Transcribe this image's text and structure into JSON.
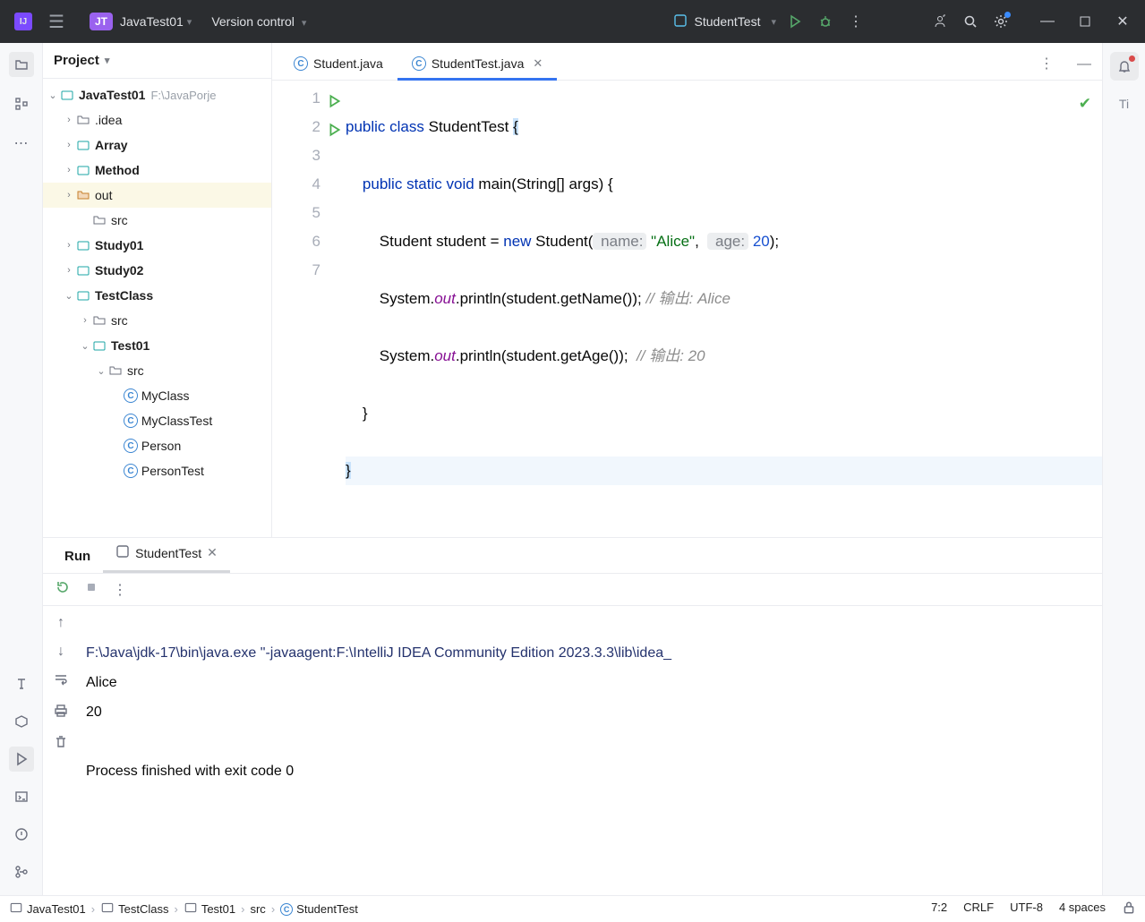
{
  "titlebar": {
    "project_badge": "JT",
    "project_name": "JavaTest01",
    "vcs_label": "Version control",
    "run_config": "StudentTest"
  },
  "project_panel": {
    "title": "Project",
    "root": {
      "name": "JavaTest01",
      "path": "F:\\JavaPorje"
    },
    "folders_top": [
      ".idea",
      "Array",
      "Method"
    ],
    "selected_folder": "out",
    "src_folder": "src",
    "folders_mid": [
      "Study01",
      "Study02"
    ],
    "testclass": "TestClass",
    "testclass_src": "src",
    "test01": "Test01",
    "test01_src": "src",
    "classes": [
      "MyClass",
      "MyClassTest",
      "Person",
      "PersonTest"
    ]
  },
  "editor": {
    "tabs": [
      {
        "label": "Student.java",
        "active": false
      },
      {
        "label": "StudentTest.java",
        "active": true
      }
    ],
    "line_numbers": [
      "1",
      "2",
      "3",
      "4",
      "5",
      "6",
      "7"
    ]
  },
  "code": {
    "kw_public": "public",
    "kw_class": "class",
    "classname": "StudentTest",
    "kw_static": "static",
    "kw_void": "void",
    "main": "main",
    "args": "(String[] args) {",
    "student_decl": "Student student = ",
    "kw_new": "new",
    "ctor": " Student(",
    "hint_name": " name:",
    "str_alice": "\"Alice\"",
    "hint_age": " age:",
    "num_20": "20",
    "ctor_end": ");",
    "sys": "System.",
    "out": "out",
    "println1": ".println(student.getName());",
    "println2": ".println(student.getAge());",
    "comment1": "// 输出: Alice",
    "comment2": "// 输出: 20",
    "close_brace_inner": "}",
    "close_brace_outer": "}"
  },
  "run": {
    "tab_run": "Run",
    "tab_config": "StudentTest",
    "output_cmd": "F:\\Java\\jdk-17\\bin\\java.exe \"-javaagent:F:\\IntelliJ IDEA Community Edition 2023.3.3\\lib\\idea_",
    "output_lines": [
      "Alice",
      "20",
      "",
      "Process finished with exit code 0"
    ]
  },
  "breadcrumb": [
    "JavaTest01",
    "TestClass",
    "Test01",
    "src",
    "StudentTest"
  ],
  "status": {
    "pos": "7:2",
    "sep": "CRLF",
    "enc": "UTF-8",
    "indent": "4 spaces"
  },
  "right_strip_ti": "Ti"
}
